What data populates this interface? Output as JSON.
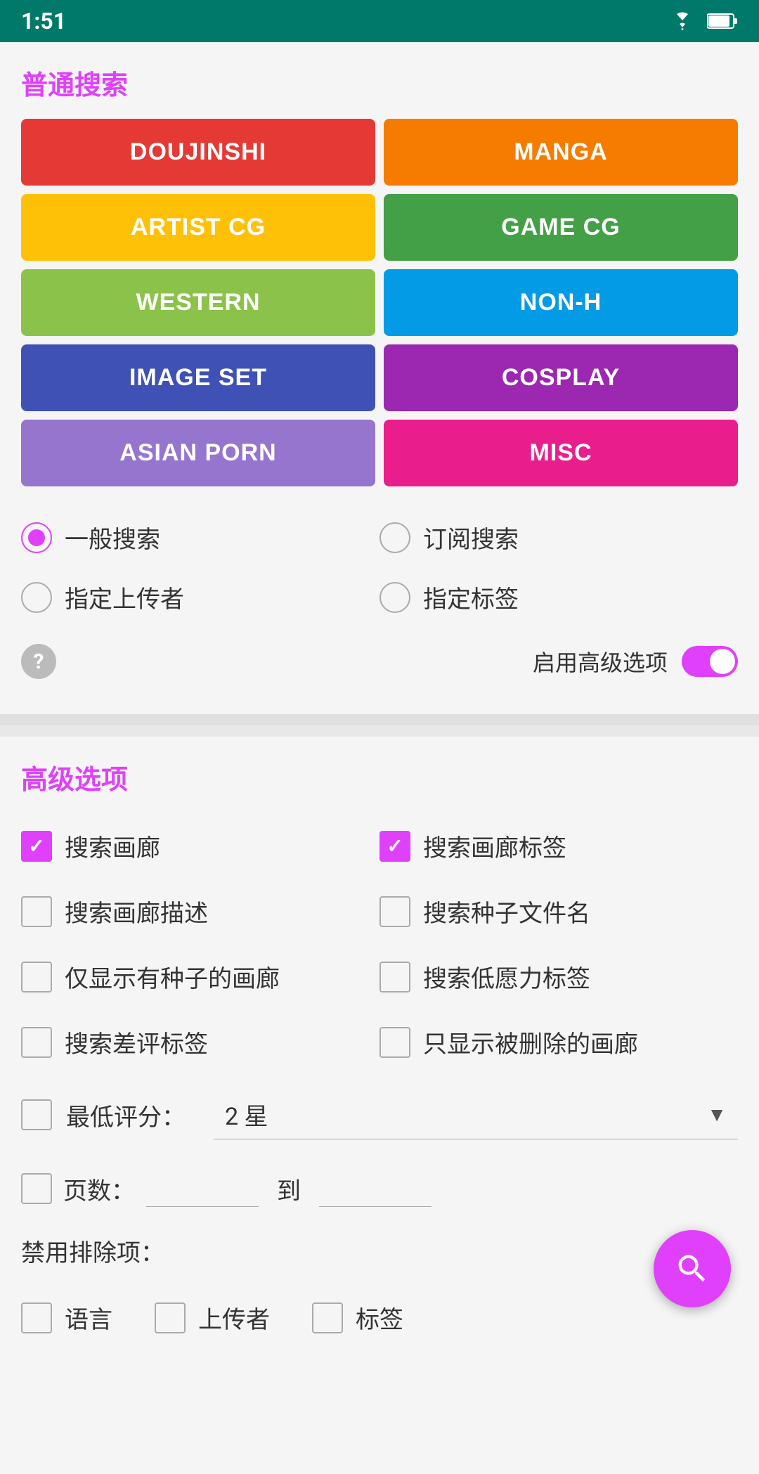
{
  "statusBar": {
    "time": "1:51",
    "wifi": "wifi-icon",
    "battery": "battery-icon"
  },
  "normalSearch": {
    "sectionTitle": "普通搜索",
    "buttons": [
      {
        "label": "DOUJINSHI",
        "class": "btn-doujinshi",
        "name": "doujinshi"
      },
      {
        "label": "MANGA",
        "class": "btn-manga",
        "name": "manga"
      },
      {
        "label": "ARTIST CG",
        "class": "btn-artist-cg",
        "name": "artist-cg"
      },
      {
        "label": "GAME CG",
        "class": "btn-game-cg",
        "name": "game-cg"
      },
      {
        "label": "WESTERN",
        "class": "btn-western",
        "name": "western"
      },
      {
        "label": "NON-H",
        "class": "btn-non-h",
        "name": "non-h"
      },
      {
        "label": "IMAGE SET",
        "class": "btn-image-set",
        "name": "image-set"
      },
      {
        "label": "COSPLAY",
        "class": "btn-cosplay",
        "name": "cosplay"
      },
      {
        "label": "ASIAN PORN",
        "class": "btn-asian-porn",
        "name": "asian-porn"
      },
      {
        "label": "MISC",
        "class": "btn-misc",
        "name": "misc"
      }
    ],
    "radioOptions": [
      {
        "label": "一般搜索",
        "selected": true,
        "name": "general-search"
      },
      {
        "label": "订阅搜索",
        "selected": false,
        "name": "subscription-search"
      },
      {
        "label": "指定上传者",
        "selected": false,
        "name": "specify-uploader"
      },
      {
        "label": "指定标签",
        "selected": false,
        "name": "specify-tag"
      }
    ],
    "advancedToggle": {
      "label": "启用高级选项",
      "enabled": true
    }
  },
  "advancedOptions": {
    "sectionTitle": "高级选项",
    "checkboxes": [
      {
        "label": "搜索画廊",
        "checked": true,
        "name": "search-gallery"
      },
      {
        "label": "搜索画廊标签",
        "checked": true,
        "name": "search-gallery-tag"
      },
      {
        "label": "搜索画廊描述",
        "checked": false,
        "name": "search-gallery-desc"
      },
      {
        "label": "搜索种子文件名",
        "checked": false,
        "name": "search-torrent"
      },
      {
        "label": "仅显示有种子的画廊",
        "checked": false,
        "name": "only-torrent"
      },
      {
        "label": "搜索低愿力标签",
        "checked": false,
        "name": "search-low-power"
      },
      {
        "label": "搜索差评标签",
        "checked": false,
        "name": "search-bad-tags"
      },
      {
        "label": "只显示被删除的画廊",
        "checked": false,
        "name": "show-deleted"
      }
    ],
    "minRating": {
      "checkboxChecked": false,
      "label": "最低评分：",
      "value": "2 星",
      "name": "min-rating"
    },
    "pageRange": {
      "checkboxChecked": false,
      "label": "页数：",
      "separator": "到",
      "fromPlaceholder": "",
      "toPlaceholder": ""
    },
    "excludeLabel": "禁用排除项：",
    "excludeItems": [
      {
        "label": "语言",
        "checked": false,
        "name": "exclude-language"
      },
      {
        "label": "上传者",
        "checked": false,
        "name": "exclude-uploader"
      },
      {
        "label": "标签",
        "checked": false,
        "name": "exclude-tag"
      }
    ]
  },
  "fab": {
    "label": "search-fab"
  }
}
